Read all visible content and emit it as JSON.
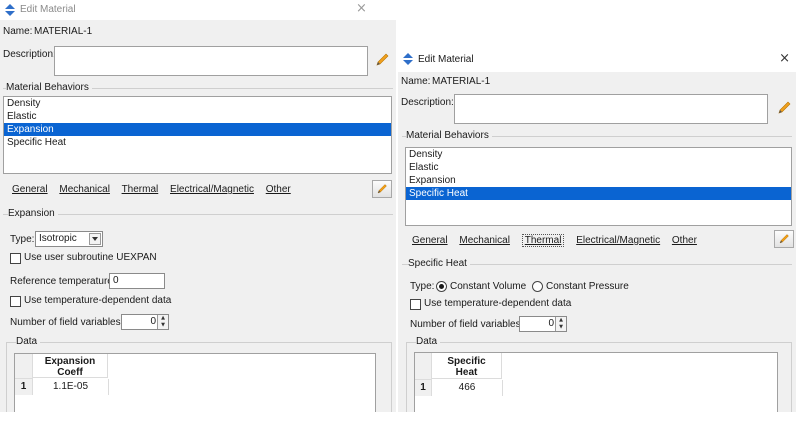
{
  "left_window": {
    "title": "Edit Material",
    "close_glyph": "×",
    "name_label": "Name:",
    "name_value": "MATERIAL-1",
    "description_label": "Description:",
    "behaviors_label": "Material Behaviors",
    "behaviors": [
      "Density",
      "Elastic",
      "Expansion",
      "Specific Heat"
    ],
    "selected_behavior": "Expansion",
    "menus": [
      "General",
      "Mechanical",
      "Thermal",
      "Electrical/Magnetic",
      "Other"
    ],
    "section_label": "Expansion",
    "type_label": "Type:",
    "type_value": "Isotropic",
    "subroutine_label": "Use user subroutine UEXPAN",
    "ref_temp_label": "Reference temperature:",
    "ref_temp_value": "0",
    "temp_dep_label": "Use temperature-dependent data",
    "field_vars_label": "Number of field variables:",
    "field_vars_value": "0",
    "data_label": "Data",
    "table": {
      "header_line1": "Expansion",
      "header_line2": "Coeff",
      "row_index": "1",
      "row_value": "1.1E-05"
    }
  },
  "right_window": {
    "title": "Edit Material",
    "close_glyph": "×",
    "name_label": "Name:",
    "name_value": "MATERIAL-1",
    "description_label": "Description:",
    "behaviors_label": "Material Behaviors",
    "behaviors": [
      "Density",
      "Elastic",
      "Expansion",
      "Specific Heat"
    ],
    "selected_behavior": "Specific Heat",
    "menus": [
      "General",
      "Mechanical",
      "Thermal",
      "Electrical/Magnetic",
      "Other"
    ],
    "active_menu": "Thermal",
    "section_label": "Specific Heat",
    "type_label": "Type:",
    "type_options": [
      "Constant Volume",
      "Constant Pressure"
    ],
    "type_selected": "Constant Volume",
    "temp_dep_label": "Use temperature-dependent data",
    "field_vars_label": "Number of field variables:",
    "field_vars_value": "0",
    "data_label": "Data",
    "table": {
      "header_line1": "Specific",
      "header_line2": "Heat",
      "row_index": "1",
      "row_value": "466"
    }
  },
  "colors": {
    "selection": "#0a64d2",
    "dialog_bg": "#f0f0f0",
    "title_icon": "#2f6fc9",
    "pencil": "#f0a01e"
  },
  "icons": {
    "title_icon": "abaqus-diamond-icon",
    "edit_icon": "pencil-icon",
    "tool_icon": "pencil-tool-icon"
  }
}
